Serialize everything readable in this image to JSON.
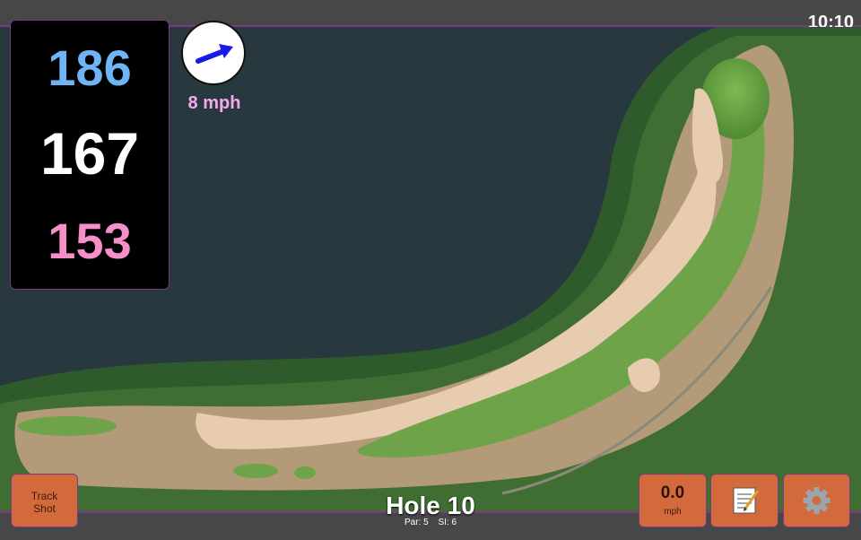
{
  "status": {
    "time": "10:10"
  },
  "distances": {
    "back": "186",
    "middle": "167",
    "front": "153"
  },
  "wind": {
    "speed": "8 mph",
    "arrow_icon": "wind-direction-arrow-icon",
    "arrow_color": "#1a1ae6"
  },
  "hole": {
    "title": "Hole 10",
    "par": "Par: 5",
    "si": "SI: 6"
  },
  "buttons": {
    "track_line1": "Track",
    "track_line2": "Shot",
    "speed_value": "0.0",
    "speed_unit": "mph",
    "notes_icon": "notepad-icon",
    "settings_icon": "gear-icon"
  },
  "colors": {
    "accent_border": "#7a3a86",
    "button": "#d36a3c",
    "water": "#27383f",
    "fairway": "#6fa34a",
    "sand": "#e8ccb0"
  }
}
